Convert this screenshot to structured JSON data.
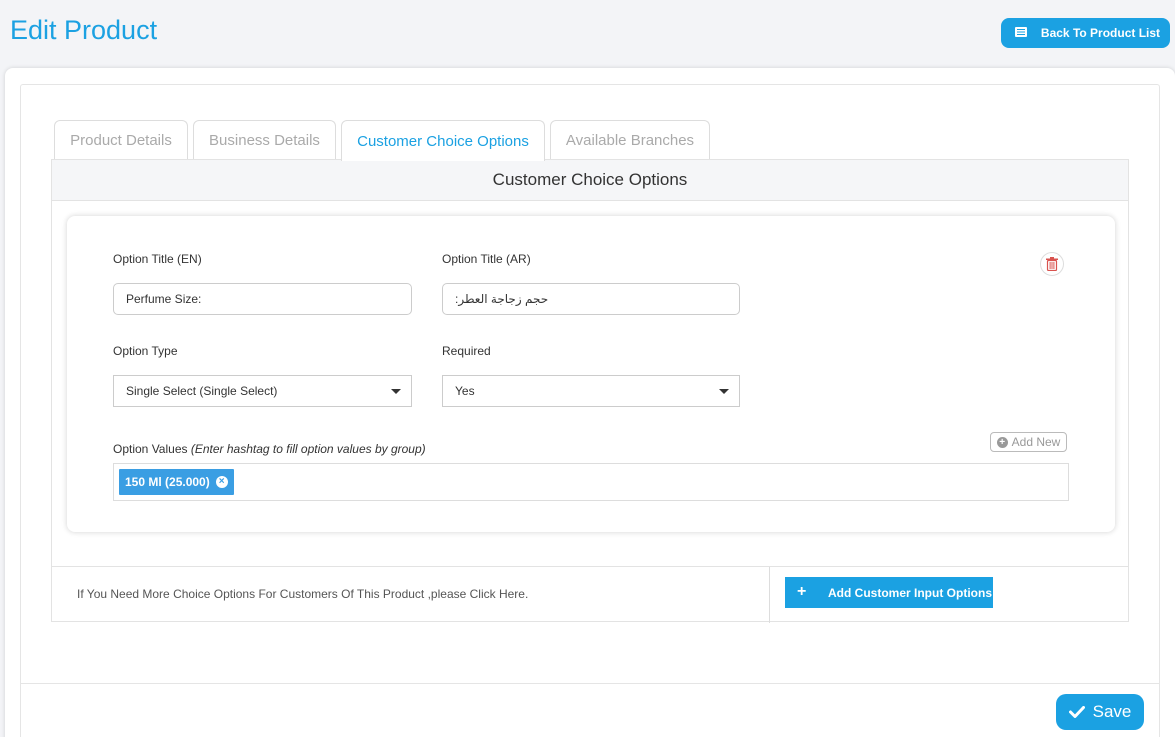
{
  "header": {
    "title": "Edit Product",
    "back_button_label": "Back To Product List"
  },
  "tabs": [
    {
      "label": "Product Details",
      "active": false
    },
    {
      "label": "Business Details",
      "active": false
    },
    {
      "label": "Customer Choice Options",
      "active": true
    },
    {
      "label": "Available Branches",
      "active": false
    }
  ],
  "panel": {
    "title": "Customer Choice Options"
  },
  "option": {
    "title_en_label": "Option Title (EN)",
    "title_en_value": "Perfume Size:",
    "title_ar_label": "Option Title (AR)",
    "title_ar_value": "حجم زجاجة العطر:",
    "type_label": "Option Type",
    "type_value": "Single Select (Single Select)",
    "required_label": "Required",
    "required_value": "Yes",
    "values_label": "Option Values",
    "values_hint": "(Enter hashtag to fill option values by group)",
    "add_new_label": "Add New",
    "values": [
      "150 Ml (25.000)"
    ]
  },
  "footer": {
    "hint_text": "If You Need More Choice Options For Customers Of This Product ,please Click Here.",
    "add_button_label": "Add Customer Input Options"
  },
  "save_label": "Save",
  "colors": {
    "accent": "#1ba1e2",
    "tag": "#3a9ee3",
    "danger": "#d9534f"
  }
}
